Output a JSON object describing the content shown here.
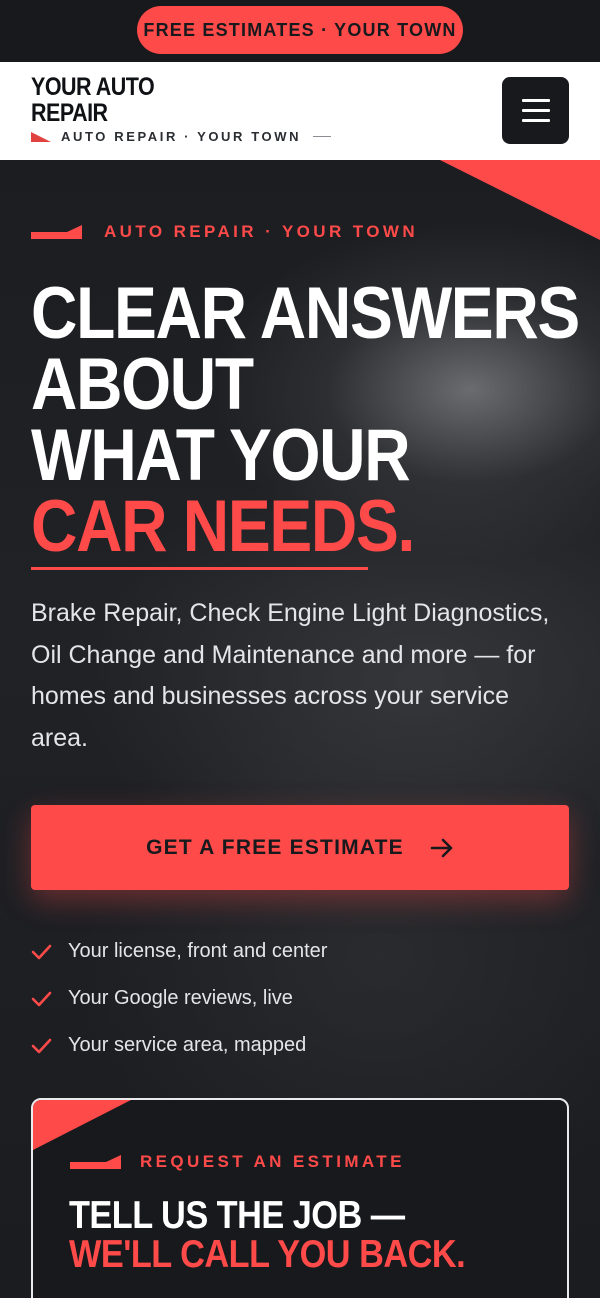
{
  "promo": {
    "label": "FREE ESTIMATES · YOUR TOWN"
  },
  "header": {
    "logo_line1": "YOUR AUTO",
    "logo_line2": "REPAIR",
    "tagline": "AUTO REPAIR · YOUR TOWN",
    "menu_icon": "hamburger-menu-icon"
  },
  "hero": {
    "eyebrow": "AUTO REPAIR · YOUR TOWN",
    "headline_lines": [
      "CLEAR ANSWERS",
      "ABOUT",
      "WHAT YOUR"
    ],
    "headline_accent": "CAR NEEDS.",
    "lede": "Brake Repair, Check Engine Light Diagnostics, Oil Change and Maintenance and more — for homes and businesses across your service area.",
    "cta_label": "GET A FREE ESTIMATE",
    "cta_icon": "arrow-right-icon",
    "checks": [
      "Your license, front and center",
      "Your Google reviews, live",
      "Your service area, mapped"
    ],
    "check_icon": "checkmark-icon"
  },
  "card": {
    "eyebrow": "REQUEST AN ESTIMATE",
    "title_line1": "TELL US THE JOB —",
    "title_line2": "WE'LL CALL YOU BACK."
  },
  "colors": {
    "accent": "#ff4a4a",
    "dark": "#17191c",
    "white": "#ffffff"
  }
}
